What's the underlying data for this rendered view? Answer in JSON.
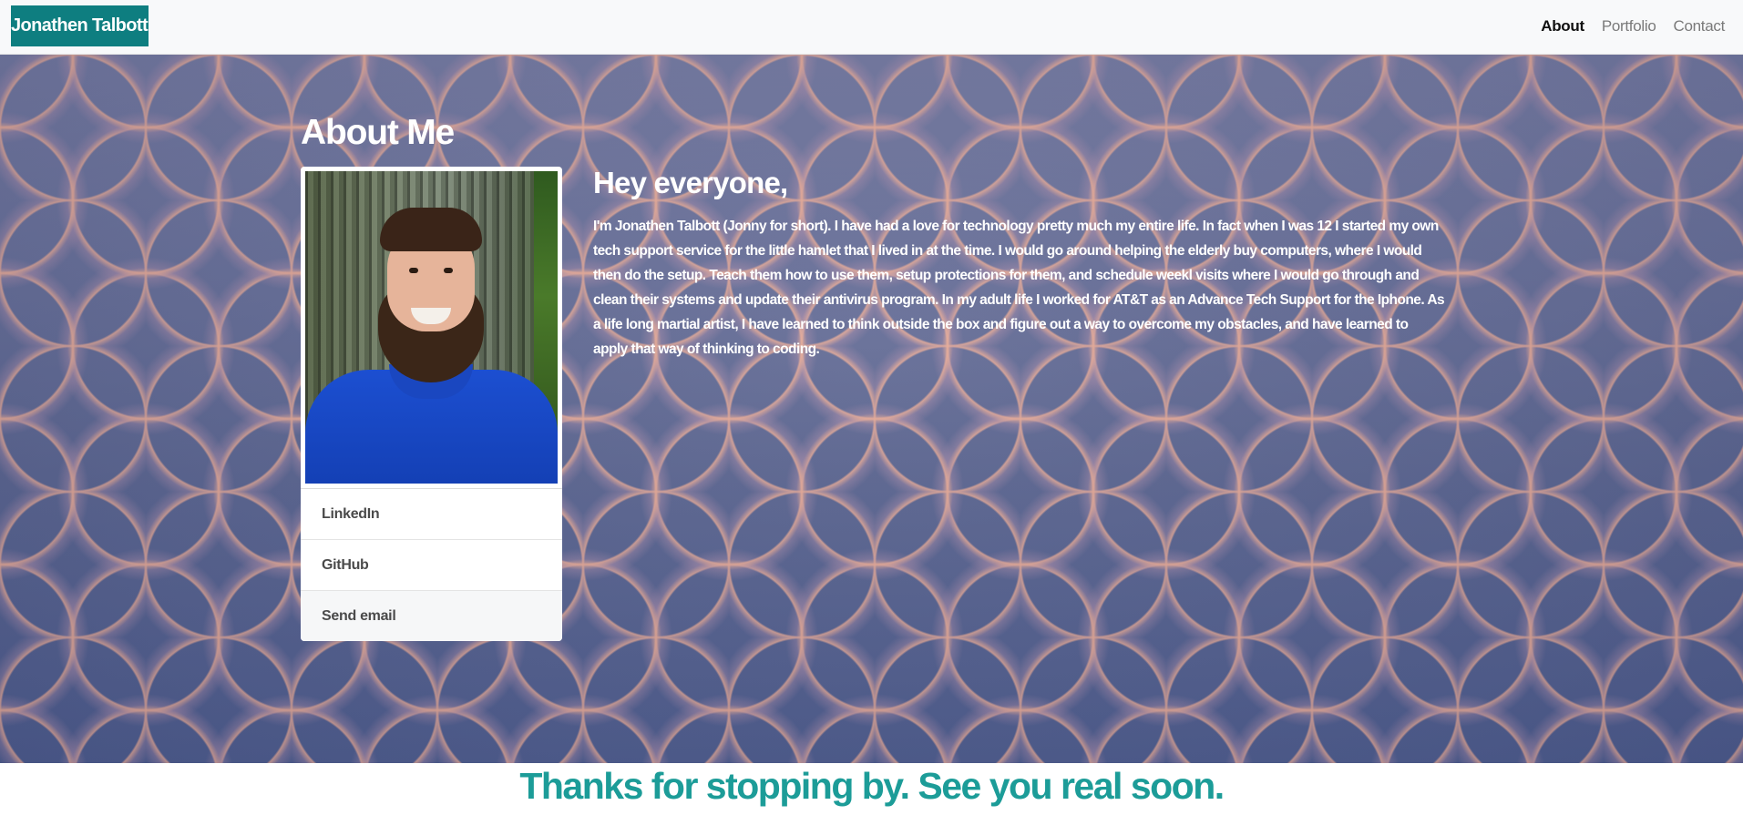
{
  "navbar": {
    "brand": "Jonathen Talbott",
    "links": [
      {
        "label": "About",
        "active": true
      },
      {
        "label": "Portfolio",
        "active": false
      },
      {
        "label": "Contact",
        "active": false
      }
    ]
  },
  "about": {
    "title": "About Me",
    "profile_links": [
      {
        "label": "LinkedIn"
      },
      {
        "label": "GitHub"
      },
      {
        "label": "Send email"
      }
    ],
    "greeting": "Hey everyone,",
    "bio": "I'm Jonathen Talbott (Jonny for short). I have had a love for technology pretty much my entire life. In fact when I was 12 I started my own tech support service for the little hamlet that I lived in at the time. I would go around helping the elderly buy computers, where I would then do the setup. Teach them how to use them, setup protections for them, and schedule weekl visits where I would go through and clean their systems and update their antivirus program. In my adult life I worked for AT&T as an Advance Tech Support for the Iphone. As a life long martial artist, I have learned to think outside the box and figure out a way to overcome my obstacles, and have learned to apply that way of thinking to coding."
  },
  "footer": {
    "text": "Thanks for stopping by. See you real soon."
  },
  "colors": {
    "brand_background": "#0e7e80",
    "footer_text": "#1c9c98",
    "navbar_background": "#f8f9fa"
  }
}
